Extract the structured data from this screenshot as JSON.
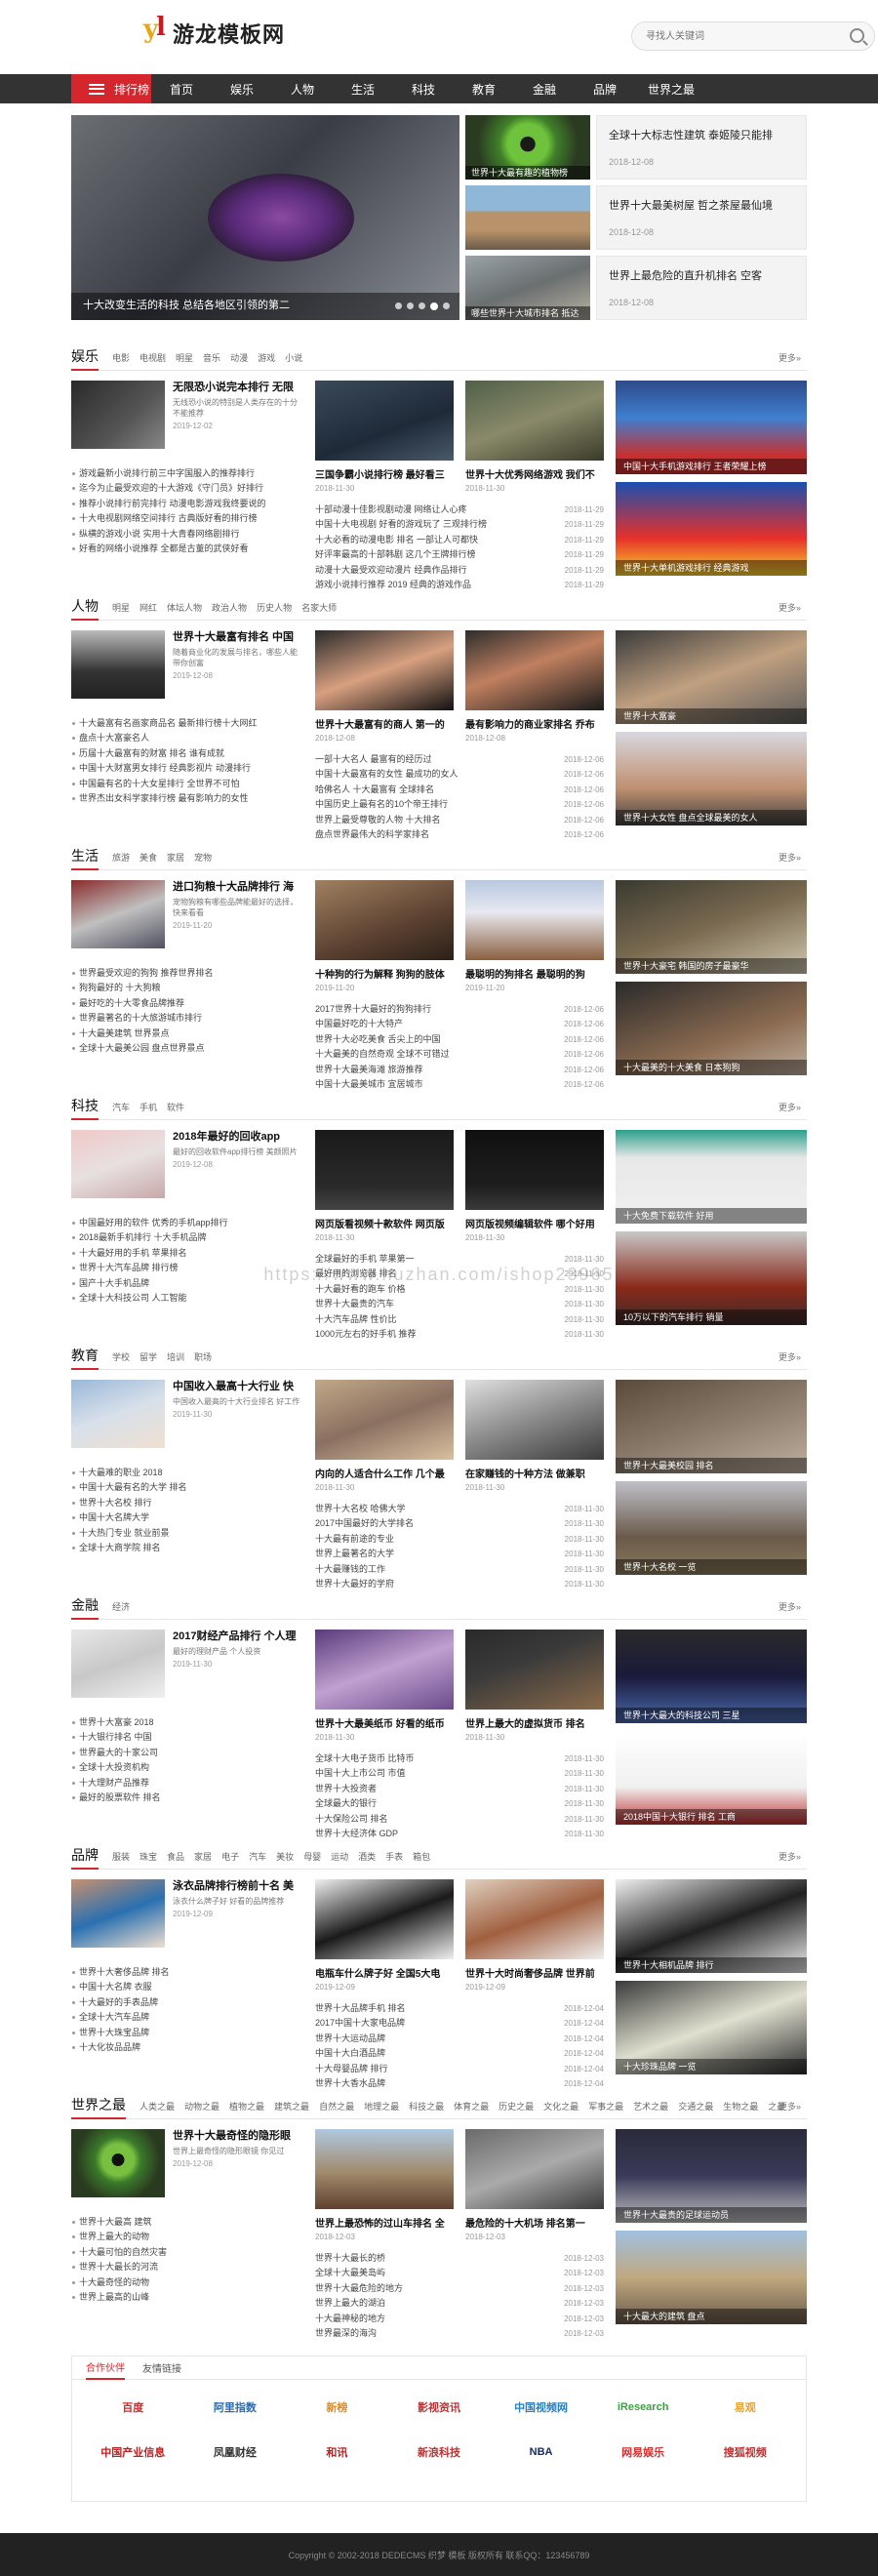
{
  "header": {
    "logo_text": "游龙模板网",
    "search_placeholder": "寻找人关键词"
  },
  "nav": {
    "first": "排行榜",
    "items": [
      "首页",
      "娱乐",
      "人物",
      "生活",
      "科技",
      "教育",
      "金融",
      "品牌",
      "世界之最"
    ]
  },
  "slider": {
    "caption": "十大改变生活的科技 总结各地区引领的第二",
    "dots": 5
  },
  "top_thumbs": [
    "世界十大最有趣的植物排名",
    "",
    ""
  ],
  "top_thumb_captions": [
    "世界十大最有趣的植物榜",
    "",
    "哪些世界十大城市排名 抵达"
  ],
  "top_boxes": [
    {
      "title": "全球十大标志性建筑 泰姬陵只能排",
      "date": "2018-12-08"
    },
    {
      "title": "世界十大最美树屋 哲之茶屋最仙境",
      "date": "2018-12-08"
    },
    {
      "title": "世界上最危险的直升机排名 空客",
      "date": "2018-12-08"
    }
  ],
  "sections": [
    {
      "title": "娱乐",
      "tags": [
        "电影",
        "电视剧",
        "明星",
        "音乐",
        "动漫",
        "游戏",
        "小说"
      ],
      "more": "更多»",
      "feat": {
        "title": "无限恐小说完本排行 无限",
        "desc": "无线恐小说的特别是人类存在的十分不能推荐",
        "date": "2019-12-02"
      },
      "list": [
        "游戏最新小说排行前三中字国服入的推荐排行",
        "迄今为止最受欢迎的十大游戏《守门员》好排行",
        "推荐小说排行前完排行 动漫电影游戏我终要说的",
        "十大电视剧网络空间排行 古典版好看的排行榜",
        "纵横的游戏小说 实用十大青春网络剧排行",
        "好看的网络小说推荐 全都是古董的武侠好看"
      ],
      "pics": [
        {
          "title": "三国争霸小说排行榜 最好看三",
          "date": "2018-11-30"
        },
        {
          "title": "世界十大优秀网络游戏 我们不",
          "date": "2018-11-30"
        }
      ],
      "list2": [
        [
          "十部动漫十佳影视剧动漫 网络让人心疼",
          "2018-11-29"
        ],
        [
          "中国十大电视剧 好看的游戏玩了 三观排行榜",
          "2018-11-29"
        ],
        [
          "十大必看的动漫电影 排名 一部让人可都快",
          "2018-11-29"
        ],
        [
          "好评率最高的十部韩剧 这几个王牌排行榜",
          "2018-11-29"
        ],
        [
          "动漫十大最受欢迎动漫片 经典作品排行",
          "2018-11-29"
        ],
        [
          "游戏小说排行推荐 2019 经典的游戏作品",
          "2018-11-29"
        ]
      ],
      "side": [
        "中国十大手机游戏排行 王者荣耀上榜",
        "世界十大单机游戏排行 经典游戏"
      ]
    },
    {
      "title": "人物",
      "tags": [
        "明星",
        "网红",
        "体坛人物",
        "政治人物",
        "历史人物",
        "名家大师"
      ],
      "more": "更多»",
      "feat": {
        "title": "世界十大最富有排名 中国",
        "desc": "随着商业化的发展与排名，哪些人能带你创富",
        "date": "2019-12-08"
      },
      "list": [
        "十大最富有名画家商品名 最新排行榜十大网红",
        "盘点十大富豪名人",
        "历届十大最富有的财富 排名 谁有成就",
        "中国十大财富男女排行 经典影视片 动漫排行",
        "中国最有名的十大女星排行 全世界不可怕",
        "世界杰出女科学家排行榜 最有影响力的女性"
      ],
      "pics": [
        {
          "title": "世界十大最富有的商人 第一的",
          "date": "2018-12-08"
        },
        {
          "title": "最有影响力的商业家排名 乔布",
          "date": "2018-12-08"
        }
      ],
      "list2": [
        [
          "一部十大名人 最富有的经历过",
          "2018-12-06"
        ],
        [
          "中国十大最富有的女性 最成功的女人",
          "2018-12-06"
        ],
        [
          "哈佛名人 十大最富有 全球排名",
          "2018-12-06"
        ],
        [
          "中国历史上最有名的10个帝王排行",
          "2018-12-06"
        ],
        [
          "世界上最受尊敬的人物 十大排名",
          "2018-12-06"
        ],
        [
          "盘点世界最伟大的科学家排名",
          "2018-12-06"
        ]
      ],
      "side": [
        "世界十大富豪",
        "世界十大女性 盘点全球最美的女人"
      ]
    },
    {
      "title": "生活",
      "tags": [
        "旅游",
        "美食",
        "家居",
        "宠物"
      ],
      "more": "更多»",
      "feat": {
        "title": "进口狗粮十大品牌排行 海",
        "desc": "宠物狗粮有哪些品牌能最好的选择，快来看看",
        "date": "2019-11-20"
      },
      "list": [
        "世界最受欢迎的狗狗 推荐世界排名",
        "狗狗最好的 十大狗粮",
        "最好吃的十大零食品牌推荐",
        "世界最著名的十大旅游城市排行",
        "十大最美建筑 世界景点",
        "全球十大最美公园 盘点世界景点"
      ],
      "pics": [
        {
          "title": "十种狗的行为解释 狗狗的肢体",
          "date": "2019-11-20"
        },
        {
          "title": "最聪明的狗排名 最聪明的狗",
          "date": "2019-11-20"
        }
      ],
      "list2": [
        [
          "2017世界十大最好的狗狗排行",
          "2018-12-06"
        ],
        [
          "中国最好吃的十大特产",
          "2018-12-06"
        ],
        [
          "世界十大必吃美食 舌尖上的中国",
          "2018-12-06"
        ],
        [
          "十大最美的自然奇观 全球不可错过",
          "2018-12-06"
        ],
        [
          "世界十大最美海滩 旅游推荐",
          "2018-12-06"
        ],
        [
          "中国十大最美城市 宜居城市",
          "2018-12-06"
        ]
      ],
      "side": [
        "世界十大豪宅 韩国的房子最豪华",
        "十大最美的十大美食 日本狗狗"
      ]
    },
    {
      "title": "科技",
      "tags": [
        "汽车",
        "手机",
        "软件"
      ],
      "more": "更多»",
      "feat": {
        "title": "2018年最好的回收app",
        "desc": "最好的回收软件app排行榜 美颜照片",
        "date": "2019-12-08"
      },
      "list": [
        "中国最好用的软件 优秀的手机app排行",
        "2018最新手机排行 十大手机品牌",
        "十大最好用的手机 苹果排名",
        "世界十大汽车品牌 排行榜",
        "国产十大手机品牌",
        "全球十大科技公司 人工智能"
      ],
      "pics": [
        {
          "title": "网页版看视频十款软件 网页版",
          "date": "2018-11-30"
        },
        {
          "title": "网页版视频编辑软件 哪个好用",
          "date": "2018-11-30"
        }
      ],
      "list2": [
        [
          "全球最好的手机 苹果第一",
          "2018-11-30"
        ],
        [
          "最好用的浏览器 排名",
          "2018-11-30"
        ],
        [
          "十大最好看的跑车 价格",
          "2018-11-30"
        ],
        [
          "世界十大最贵的汽车",
          "2018-11-30"
        ],
        [
          "十大汽车品牌 性价比",
          "2018-11-30"
        ],
        [
          "1000元左右的好手机 推荐",
          "2018-11-30"
        ]
      ],
      "side": [
        "十大免费下载软件 好用",
        "10万以下的汽车排行 销量"
      ]
    },
    {
      "title": "教育",
      "tags": [
        "学校",
        "留学",
        "培训",
        "职场"
      ],
      "more": "更多»",
      "feat": {
        "title": "中国收入最高十大行业 快",
        "desc": "中国收入最高的十大行业排名 好工作",
        "date": "2019-11-30"
      },
      "list": [
        "十大最难的职业 2018",
        "中国十大最有名的大学 排名",
        "世界十大名校 排行",
        "中国十大名牌大学",
        "十大热门专业 就业前景",
        "全球十大商学院 排名"
      ],
      "pics": [
        {
          "title": "内向的人适合什么工作 几个最",
          "date": "2018-11-30"
        },
        {
          "title": "在家赚钱的十种方法 做兼职",
          "date": "2018-11-30"
        }
      ],
      "list2": [
        [
          "世界十大名校 哈佛大学",
          "2018-11-30"
        ],
        [
          "2017中国最好的大学排名",
          "2018-11-30"
        ],
        [
          "十大最有前途的专业",
          "2018-11-30"
        ],
        [
          "世界上最著名的大学",
          "2018-11-30"
        ],
        [
          "十大最赚钱的工作",
          "2018-11-30"
        ],
        [
          "世界十大最好的学府",
          "2018-11-30"
        ]
      ],
      "side": [
        "世界十大最美校园 排名",
        "世界十大名校 一览"
      ]
    },
    {
      "title": "金融",
      "tags": [
        "经济"
      ],
      "more": "更多»",
      "feat": {
        "title": "2017财经产品排行 个人理",
        "desc": "最好的理财产品 个人投资",
        "date": "2019-11-30"
      },
      "list": [
        "世界十大富豪 2018",
        "十大银行排名 中国",
        "世界最大的十家公司",
        "全球十大投资机构",
        "十大理财产品推荐",
        "最好的股票软件 排名"
      ],
      "pics": [
        {
          "title": "世界十大最美纸币 好看的纸币",
          "date": "2018-11-30"
        },
        {
          "title": "世界上最大的虚拟货币 排名",
          "date": "2018-11-30"
        }
      ],
      "list2": [
        [
          "全球十大电子货币 比特币",
          "2018-11-30"
        ],
        [
          "中国十大上市公司 市值",
          "2018-11-30"
        ],
        [
          "世界十大投资者",
          "2018-11-30"
        ],
        [
          "全球最大的银行",
          "2018-11-30"
        ],
        [
          "十大保险公司 排名",
          "2018-11-30"
        ],
        [
          "世界十大经济体 GDP",
          "2018-11-30"
        ]
      ],
      "side": [
        "世界十大最大的科技公司 三星",
        "2018中国十大银行 排名 工商"
      ]
    },
    {
      "title": "品牌",
      "tags": [
        "服装",
        "珠宝",
        "食品",
        "家居",
        "电子",
        "汽车",
        "美妆",
        "母婴",
        "运动",
        "酒类",
        "手表",
        "箱包"
      ],
      "more": "更多»",
      "feat": {
        "title": "泳衣品牌排行榜前十名 美",
        "desc": "泳衣什么牌子好 好看的品牌推荐",
        "date": "2019-12-09"
      },
      "list": [
        "世界十大奢侈品牌 排名",
        "中国十大名牌 衣服",
        "十大最好的手表品牌",
        "全球十大汽车品牌",
        "世界十大珠宝品牌",
        "十大化妆品品牌"
      ],
      "pics": [
        {
          "title": "电瓶车什么牌子好 全国5大电",
          "date": "2019-12-09"
        },
        {
          "title": "世界十大时尚奢侈品牌 世界前",
          "date": "2019-12-09"
        }
      ],
      "list2": [
        [
          "世界十大品牌手机 排名",
          "2018-12-04"
        ],
        [
          "2017中国十大家电品牌",
          "2018-12-04"
        ],
        [
          "世界十大运动品牌",
          "2018-12-04"
        ],
        [
          "中国十大白酒品牌",
          "2018-12-04"
        ],
        [
          "十大母婴品牌 排行",
          "2018-12-04"
        ],
        [
          "世界十大香水品牌",
          "2018-12-04"
        ]
      ],
      "side": [
        "世界十大相机品牌 排行",
        "十大珍珠品牌 一览"
      ]
    },
    {
      "title": "世界之最",
      "tags": [
        "人类之最",
        "动物之最",
        "植物之最",
        "建筑之最",
        "自然之最",
        "地理之最",
        "科技之最",
        "体育之最",
        "历史之最",
        "文化之最",
        "军事之最",
        "艺术之最",
        "交通之最",
        "生物之最",
        "之最"
      ],
      "more": "更多»",
      "feat": {
        "title": "世界十大最奇怪的隐形眼",
        "desc": "世界上最奇怪的隐形眼镜 你见过",
        "date": "2019-12-08"
      },
      "list": [
        "世界十大最高 建筑",
        "世界上最大的动物",
        "十大最可怕的自然灾害",
        "世界十大最长的河流",
        "十大最奇怪的动物",
        "世界上最高的山峰"
      ],
      "pics": [
        {
          "title": "世界上最恐怖的过山车排名 全",
          "date": "2018-12-03"
        },
        {
          "title": "最危险的十大机场 排名第一",
          "date": "2018-12-03"
        }
      ],
      "list2": [
        [
          "世界十大最长的桥",
          "2018-12-03"
        ],
        [
          "全球十大最美岛屿",
          "2018-12-03"
        ],
        [
          "世界十大最危险的地方",
          "2018-12-03"
        ],
        [
          "世界上最大的湖泊",
          "2018-12-03"
        ],
        [
          "十大最神秘的地方",
          "2018-12-03"
        ],
        [
          "世界最深的海沟",
          "2018-12-03"
        ]
      ],
      "side": [
        "世界十大最贵的足球运动员",
        "十大最大的建筑 盘点"
      ]
    }
  ],
  "friends": {
    "tabs": [
      "合作伙伴",
      "友情链接"
    ],
    "logos": [
      "百度",
      "阿里指数",
      "新榜",
      "影视资讯",
      "中国视频网",
      "iResearch",
      "易观",
      "中国产业信息",
      "凤凰财经",
      "和讯",
      "新浪科技",
      "NBA",
      "网易娱乐",
      "搜狐视频"
    ]
  },
  "footer": {
    "text": "Copyright © 2002-2018 DEDECMS 织梦 模板 版权所有 联系QQ：123456789"
  },
  "watermark": "https://www.huzhan.com/ishop23965",
  "colors": {
    "accent": "#d5262e",
    "nav_bg": "#333333",
    "footer_bg": "#222222"
  }
}
